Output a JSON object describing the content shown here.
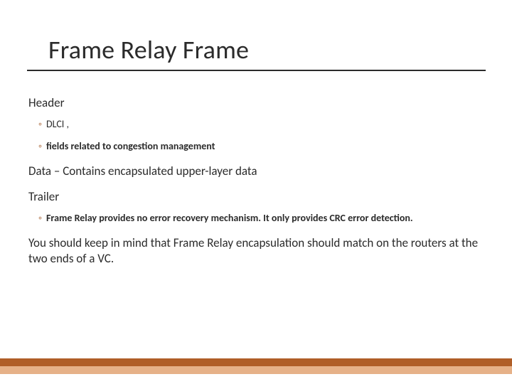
{
  "title": "Frame Relay Frame",
  "sections": {
    "header": {
      "label": "Header",
      "bullets": [
        "DLCI ,",
        " fields related to congestion management"
      ]
    },
    "data": {
      "text": "Data – Contains encapsulated upper-layer data"
    },
    "trailer": {
      "label": "Trailer",
      "bullets": [
        "Frame Relay provides no error recovery mechanism. It only provides CRC error detection."
      ]
    },
    "note": {
      "text": "You should keep in mind that Frame Relay encapsulation should match on the routers at the two ends of a VC."
    }
  }
}
